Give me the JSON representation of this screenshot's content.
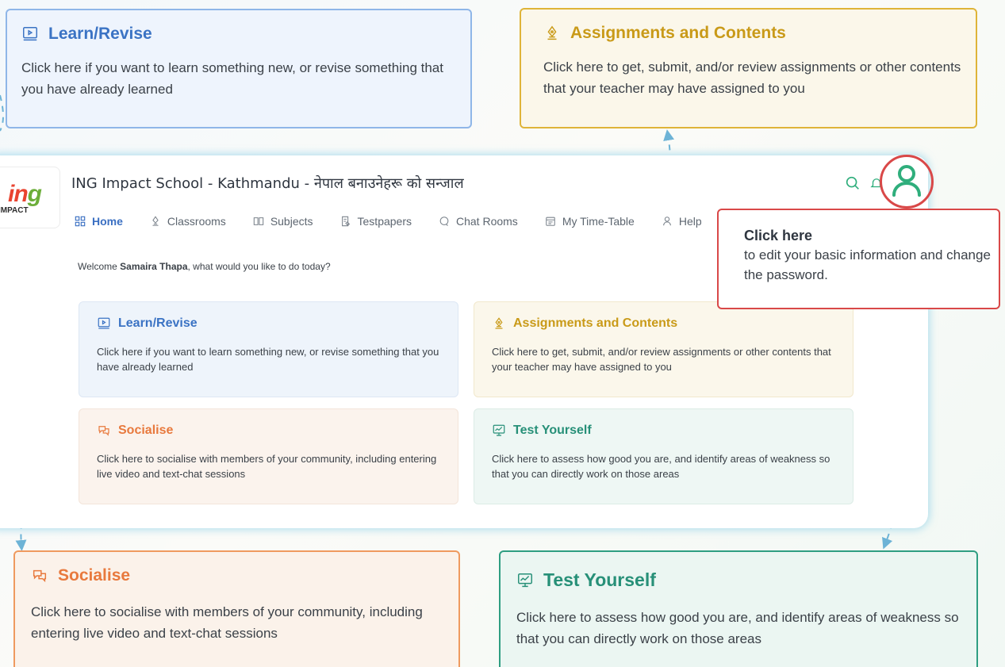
{
  "callouts": {
    "learn": {
      "title": "Learn/Revise",
      "text": "Click here if you want to learn something new, or revise something that you have already learned"
    },
    "assignments": {
      "title": "Assignments and Contents",
      "text": "Click here to get, submit, and/or review assignments or other contents that your teacher may have assigned to you"
    },
    "socialise": {
      "title": "Socialise",
      "text": "Click here to socialise with members of your community, including entering live video and text-chat sessions"
    },
    "test": {
      "title": "Test Yourself",
      "text": "Click here to assess how good you are, and identify areas of weakness so that you can directly work on those areas"
    }
  },
  "app": {
    "logo": {
      "mark_part1": "in",
      "mark_part2": "g",
      "subtitle": "IMPACT"
    },
    "title": "ING Impact School - Kathmandu - नेपाल बनाउनेहरू को सन्जाल",
    "nav": [
      {
        "label": "Home",
        "icon": "grid-icon",
        "active": true
      },
      {
        "label": "Classrooms",
        "icon": "pen-nib-icon"
      },
      {
        "label": "Subjects",
        "icon": "book-icon"
      },
      {
        "label": "Testpapers",
        "icon": "document-edit-icon"
      },
      {
        "label": "Chat Rooms",
        "icon": "chat-bubble-icon"
      },
      {
        "label": "My Time-Table",
        "icon": "calendar-icon"
      },
      {
        "label": "Help",
        "icon": "help-person-icon"
      }
    ],
    "welcome": {
      "prefix": "Welcome ",
      "user": "Samaira Thapa",
      "suffix": ", what would you like to do today?"
    },
    "header_icons": [
      "search-icon",
      "bell-icon",
      "user-profile-icon"
    ]
  },
  "tooltip": {
    "heading": "Click here",
    "body": "to edit your basic information and change the password."
  },
  "colors": {
    "learn": "#3b73c4",
    "assignments": "#c99a18",
    "socialise": "#e8793d",
    "test": "#279078",
    "highlight": "#d94848",
    "connector": "#6db3d6",
    "profile": "#2fae7c"
  }
}
